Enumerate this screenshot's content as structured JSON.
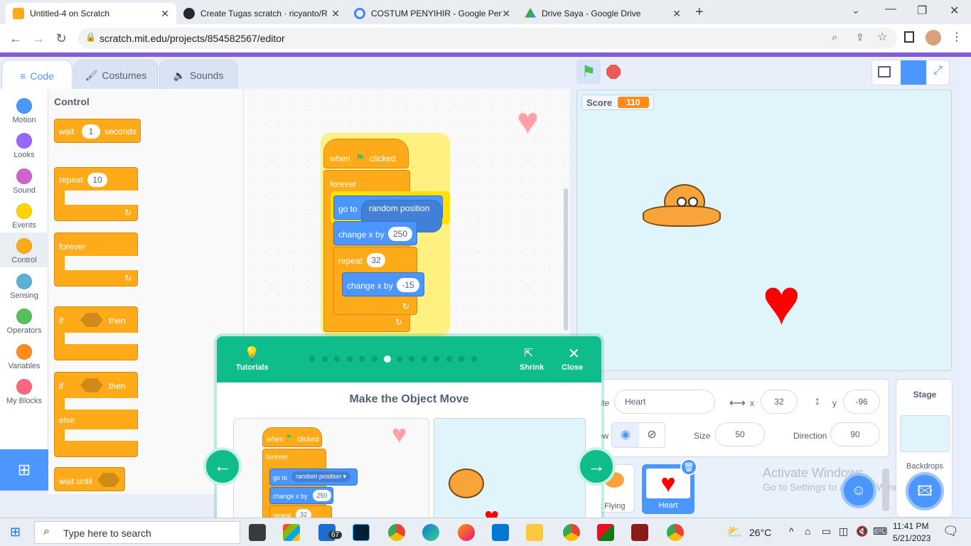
{
  "browser": {
    "tabs": [
      {
        "title": "Untitled-4 on Scratch",
        "color": "#ffab19"
      },
      {
        "title": "Create Tugas scratch · ricyanto/R",
        "color": "#24292f"
      },
      {
        "title": "COSTUM PENYIHIR - Google Pen",
        "color": "#4285f4"
      },
      {
        "title": "Drive Saya - Google Drive",
        "color": "#34a853"
      }
    ],
    "new_tab": "+",
    "url": "scratch.mit.edu/projects/854582567/editor"
  },
  "editor": {
    "tabs": [
      "Code",
      "Costumes",
      "Sounds"
    ],
    "categories": [
      {
        "label": "Motion",
        "color": "#4c97ff"
      },
      {
        "label": "Looks",
        "color": "#9966ff"
      },
      {
        "label": "Sound",
        "color": "#cf63cf"
      },
      {
        "label": "Events",
        "color": "#ffd500"
      },
      {
        "label": "Control",
        "color": "#ffab19"
      },
      {
        "label": "Sensing",
        "color": "#5cb1d6"
      },
      {
        "label": "Operators",
        "color": "#59c059"
      },
      {
        "label": "Variables",
        "color": "#ff8c1a"
      },
      {
        "label": "My Blocks",
        "color": "#ff6680"
      }
    ],
    "palette": {
      "heading": "Control",
      "wait": "wait",
      "wait_val": "1",
      "seconds": "seconds",
      "repeat": "repeat",
      "repeat_val": "10",
      "forever": "forever",
      "if": "if",
      "then": "then",
      "else": "else",
      "wait_until": "wait until"
    },
    "script": {
      "when": "when",
      "clicked": "clicked",
      "forever": "forever",
      "go_to": "go to",
      "random_position": "random position",
      "change_x_by": "change x by",
      "change_val": "250",
      "repeat": "repeat",
      "repeat_val": "32",
      "change_x_by2": "change x by",
      "change_val2": "-15"
    }
  },
  "stage": {
    "score_label": "Score",
    "score_value": "110"
  },
  "sprite_info": {
    "sprite_label": "Sprite",
    "sprite_name": "Heart",
    "x_label": "x",
    "x_value": "32",
    "y_label": "y",
    "y_value": "-96",
    "show_label": "Show",
    "size_label": "Size",
    "size_value": "50",
    "direction_label": "Direction",
    "direction_value": "90"
  },
  "sprites": [
    {
      "name": "Cat Flying"
    },
    {
      "name": "Heart"
    }
  ],
  "stage_panel": {
    "title": "Stage",
    "backdrops": "Backdrops"
  },
  "watermark": {
    "line1": "Activate Windows",
    "line2": "Go to Settings to activate Windows."
  },
  "tutorial": {
    "tutorials_label": "Tutorials",
    "shrink_label": "Shrink",
    "close_label": "Close",
    "title": "Make the Object Move",
    "step_index": 6,
    "step_count": 14,
    "mini": {
      "when": "when",
      "clicked": "clicked",
      "forever": "forever",
      "go_to": "go to",
      "random_position": "random position",
      "change_x_by": "change x by",
      "change_val": "250",
      "repeat": "repeat",
      "repeat_val": "32"
    }
  },
  "taskbar": {
    "search_placeholder": "Type here to search",
    "mail_badge": "67",
    "weather": "26°C",
    "time": "11:41 PM",
    "date": "5/21/2023"
  }
}
